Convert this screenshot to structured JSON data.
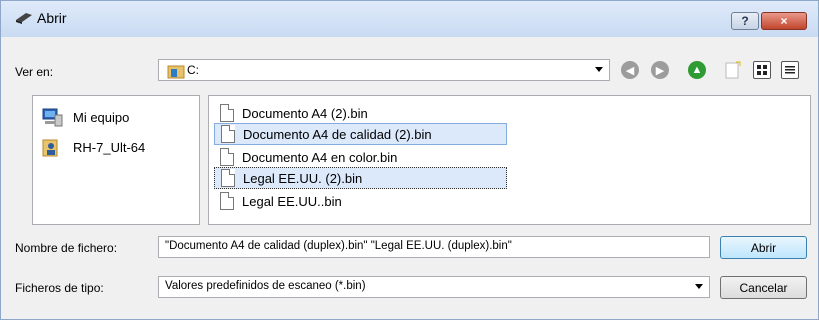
{
  "window": {
    "title": "Abrir",
    "help_label": "?",
    "close_label": "×"
  },
  "look_in": {
    "label": "Ver en:",
    "value": "C:"
  },
  "places": [
    {
      "label": "Mi equipo",
      "icon": "computer-icon"
    },
    {
      "label": "RH-7_Ult-64",
      "icon": "user-folder-icon"
    }
  ],
  "files": [
    {
      "name": "Documento A4 (2).bin",
      "selected": false
    },
    {
      "name": "Documento A4 de calidad (2).bin",
      "selected": true
    },
    {
      "name": "Documento A4 en color.bin",
      "selected": false
    },
    {
      "name": "Legal EE.UU. (2).bin",
      "selected": true,
      "focused": true
    },
    {
      "name": "Legal EE.UU..bin",
      "selected": false
    }
  ],
  "filename": {
    "label": "Nombre de fichero:",
    "value": "\"Documento A4 de calidad (duplex).bin\" \"Legal EE.UU. (duplex).bin\""
  },
  "filetype": {
    "label": "Ficheros de tipo:",
    "value": "Valores predefinidos de escaneo (*.bin)"
  },
  "buttons": {
    "open": "Abrir",
    "cancel": "Cancelar"
  },
  "colors": {
    "titlebar": "#c9dbf2",
    "selection": "#dbe9fb",
    "close": "#c0452d"
  }
}
